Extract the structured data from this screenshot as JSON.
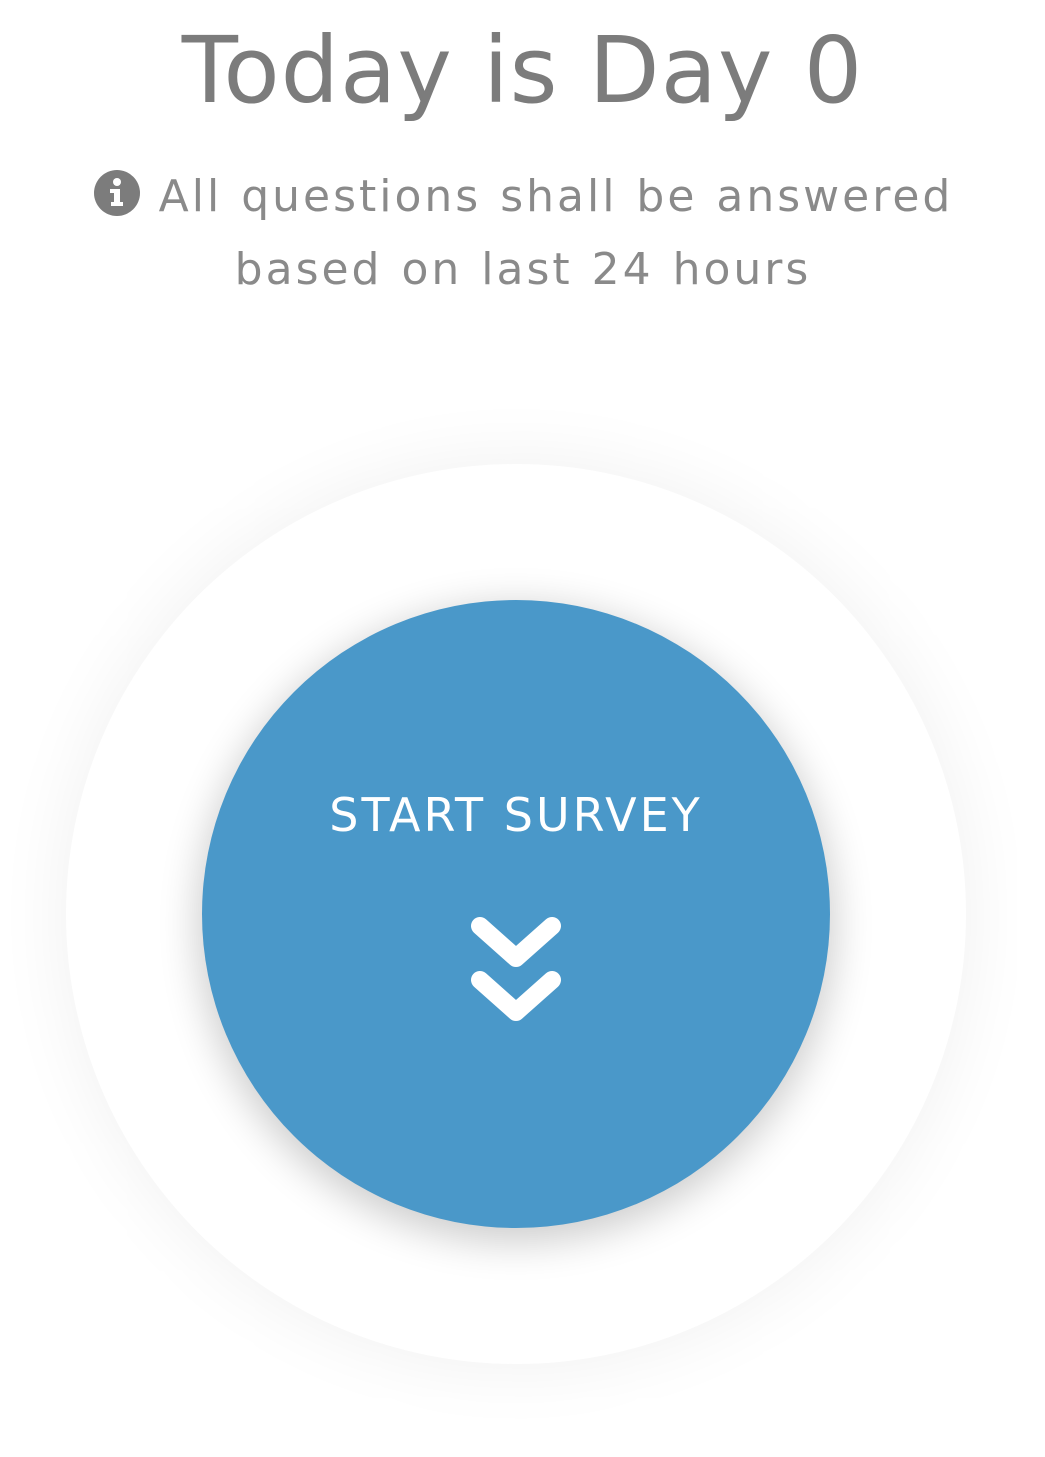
{
  "header": {
    "title": "Today is Day 0"
  },
  "notice": {
    "icon": "info-circle-icon",
    "text": "All questions shall be answered based on last 24 hours"
  },
  "survey": {
    "button_label": "START SURVEY",
    "icon": "double-chevron-down-icon"
  },
  "colors": {
    "primary": "#4a98c9",
    "text_gray": "#7c7c7c",
    "button_text": "#ffffff"
  }
}
